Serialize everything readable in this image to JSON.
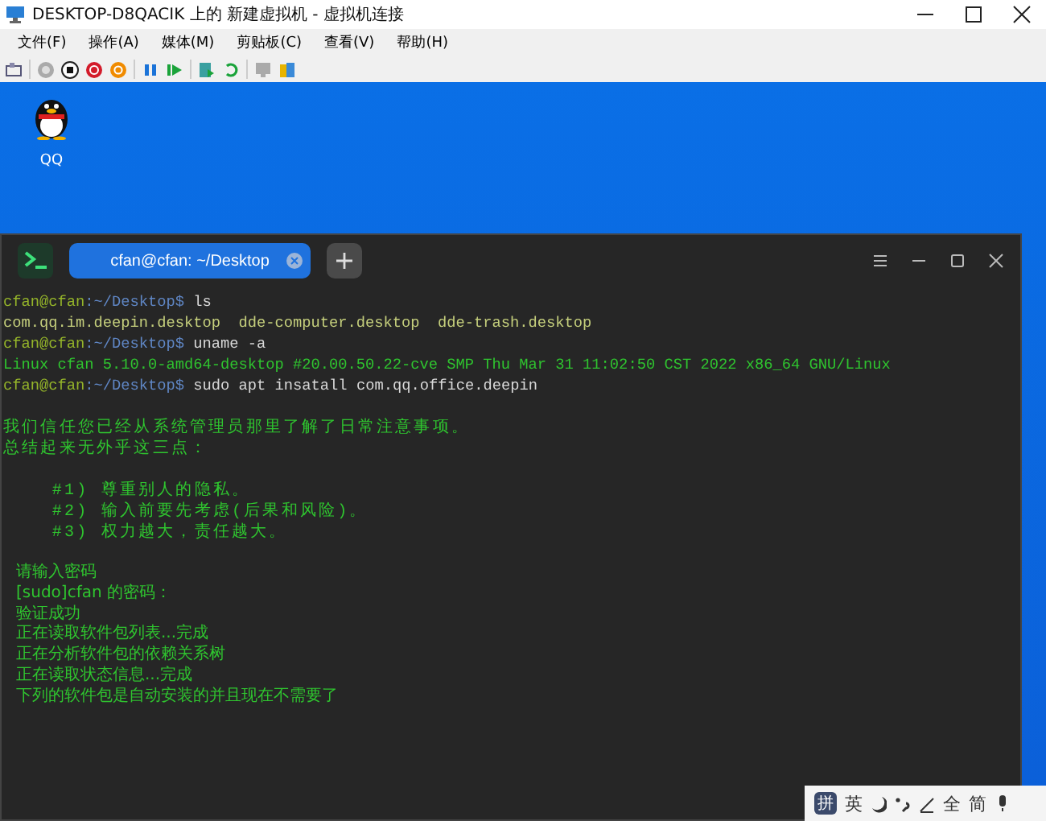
{
  "window": {
    "title": "DESKTOP-D8QACIK 上的 新建虚拟机 - 虚拟机连接"
  },
  "menu": [
    "文件(F)",
    "操作(A)",
    "媒体(M)",
    "剪贴板(C)",
    "查看(V)",
    "帮助(H)"
  ],
  "toolbar": [
    {
      "kind": "ctrl-alt-del"
    },
    {
      "kind": "sep"
    },
    {
      "kind": "start",
      "disabled": true
    },
    {
      "kind": "turn-off"
    },
    {
      "kind": "shutdown"
    },
    {
      "kind": "save"
    },
    {
      "kind": "sep"
    },
    {
      "kind": "pause"
    },
    {
      "kind": "resume"
    },
    {
      "kind": "sep"
    },
    {
      "kind": "checkpoint"
    },
    {
      "kind": "revert"
    },
    {
      "kind": "sep"
    },
    {
      "kind": "enhanced",
      "disabled": true
    },
    {
      "kind": "share"
    }
  ],
  "desktop": {
    "icons": [
      {
        "label": "QQ"
      }
    ]
  },
  "terminal": {
    "tabs": [
      {
        "label": "cfan@cfan: ~/Desktop",
        "selected": true
      }
    ],
    "lines": [
      {
        "kind": "prompt",
        "user": "cfan@cfan",
        "path": ":~/Desktop$",
        "command": "ls"
      },
      {
        "kind": "output",
        "text": "com.qq.im.deepin.desktop  dde-computer.desktop  dde-trash.desktop",
        "color": "#c5cf7c"
      },
      {
        "kind": "prompt",
        "user": "cfan@cfan",
        "path": ":~/Desktop$",
        "command": "uname -a"
      },
      {
        "kind": "output",
        "text": "Linux cfan 5.10.0-amd64-desktop #20.00.50.22-cve SMP Thu Mar 31 11:02:50 CST 2022 x86_64 GNU/Linux",
        "color": "#2fc42f"
      },
      {
        "kind": "prompt",
        "user": "cfan@cfan",
        "path": ":~/Desktop$",
        "command": "sudo apt insatall com.qq.office.deepin"
      },
      {
        "kind": "blank"
      },
      {
        "kind": "wide",
        "text": "我们信任您已经从系统管理员那里了解了日常注意事项。"
      },
      {
        "kind": "wide",
        "text": "总结起来无外乎这三点："
      },
      {
        "kind": "blank"
      },
      {
        "kind": "wide",
        "text": "    #1) 尊重别人的隐私。"
      },
      {
        "kind": "wide",
        "text": "    #2) 输入前要先考虑(后果和风险)。"
      },
      {
        "kind": "wide",
        "text": "    #3) 权力越大，责任越大。"
      },
      {
        "kind": "blank"
      },
      {
        "kind": "sans",
        "text": "请输入密码"
      },
      {
        "kind": "sans",
        "text": "[sudo]cfan 的密码："
      },
      {
        "kind": "sans",
        "text": "验证成功"
      },
      {
        "kind": "sans",
        "text": "正在读取软件包列表...完成"
      },
      {
        "kind": "sans",
        "text": "正在分析软件包的依赖关系树"
      },
      {
        "kind": "sans",
        "text": "正在读取状态信息...完成"
      },
      {
        "kind": "sans",
        "text": "下列的软件包是自动安装的并且现在不需要了"
      }
    ]
  },
  "ime": {
    "items": [
      "拼",
      "英",
      "全",
      "简"
    ]
  }
}
